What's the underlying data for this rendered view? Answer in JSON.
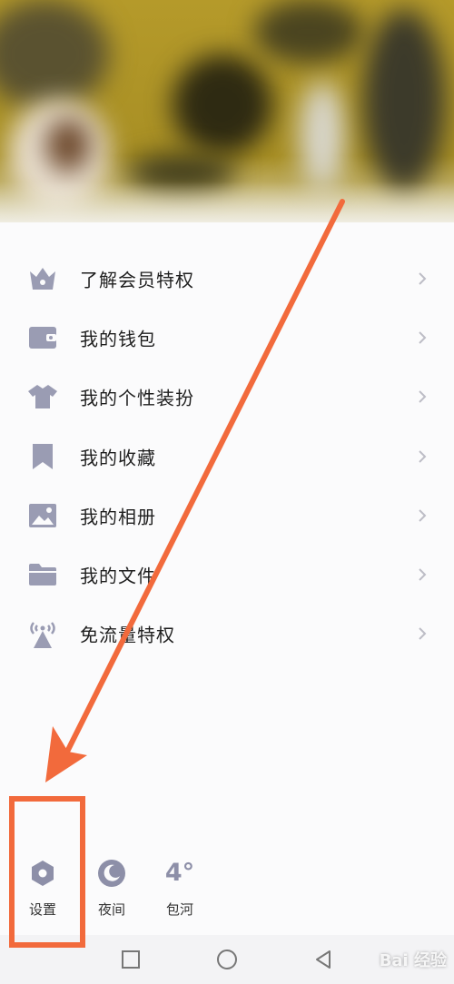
{
  "menu": {
    "items": [
      {
        "label": "了解会员特权",
        "icon": "crown-icon"
      },
      {
        "label": "我的钱包",
        "icon": "wallet-icon"
      },
      {
        "label": "我的个性装扮",
        "icon": "shirt-icon"
      },
      {
        "label": "我的收藏",
        "icon": "bookmark-icon"
      },
      {
        "label": "我的相册",
        "icon": "photo-icon"
      },
      {
        "label": "我的文件",
        "icon": "folder-icon"
      },
      {
        "label": "免流量特权",
        "icon": "signal-tower-icon"
      }
    ]
  },
  "toolbar": {
    "settings_label": "设置",
    "night_label": "夜间",
    "weather_temp": "4°",
    "weather_city": "包河"
  },
  "navbar": {
    "recent_icon": "square-icon",
    "home_icon": "circle-icon",
    "back_icon": "triangle-back-icon"
  },
  "watermark": {
    "text": "Bai 经验"
  },
  "colors": {
    "icon_gray": "#9a9cb3",
    "annotation_orange": "#f26a3c",
    "header_mustard": "#b59a2a"
  }
}
